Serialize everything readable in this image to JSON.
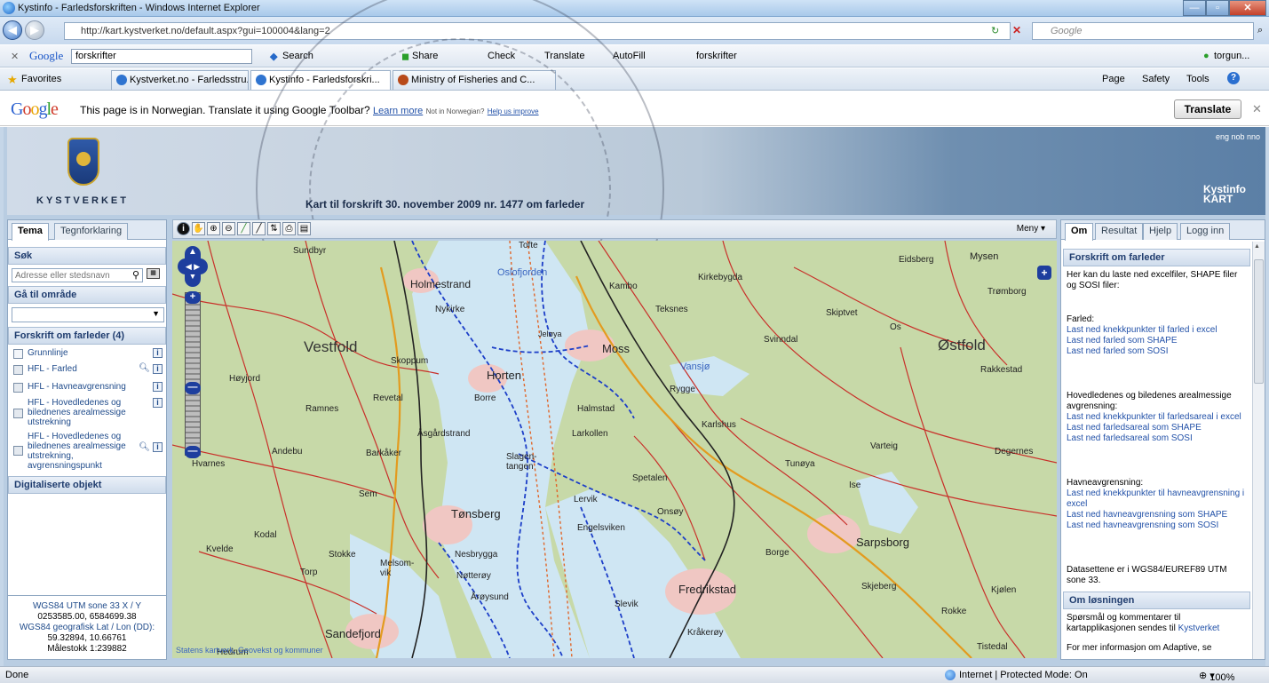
{
  "window": {
    "title": "Kystinfo - Farledsforskriften - Windows Internet Explorer"
  },
  "address": {
    "url": "http://kart.kystverket.no/default.aspx?gui=100004&lang=2",
    "search_placeholder": "Google"
  },
  "google_toolbar": {
    "query": "forskrifter",
    "search": "Search",
    "share": "Share",
    "check": "Check",
    "translate": "Translate",
    "autofill": "AutoFill",
    "highlight_term": "forskrifter",
    "user": "torgun..."
  },
  "favorites": {
    "label": "Favorites",
    "tabs": [
      "Kystverket.no - Farledsstru...",
      "Kystinfo - Farledsforskri...",
      "Ministry of Fisheries and C..."
    ],
    "commands": {
      "page": "Page",
      "safety": "Safety",
      "tools": "Tools"
    }
  },
  "translate_bar": {
    "message": "This page is in Norwegian.  Translate it using Google Toolbar?",
    "learn_more": "Learn more",
    "not_norwegian": "Not in Norwegian?",
    "help": "Help us improve",
    "button": "Translate"
  },
  "banner": {
    "brand": "KYSTVERKET",
    "subtitle": "Kart til forskrift 30. november 2009 nr. 1477 om farleder",
    "languages": "eng nob nno",
    "product_line1": "Kystinfo",
    "product_line2": "KART"
  },
  "left_panel": {
    "tabs": [
      "Tema",
      "Tegnforklaring"
    ],
    "search_title": "Søk",
    "search_placeholder": "Adresse eller stedsnavn",
    "goto_title": "Gå til område",
    "layers_title": "Forskrift om farleder (4)",
    "layers": [
      {
        "label": "Grunnlinje"
      },
      {
        "label": "HFL - Farled"
      },
      {
        "label": "HFL - Havneavgrensning"
      },
      {
        "label": "HFL - Hovedledenes og bilednenes arealmessige utstrekning"
      },
      {
        "label": "HFL - Hovedledenes og bilednenes arealmessige utstrekning, avgrensningspunkt"
      }
    ],
    "digital_title": "Digitaliserte objekt",
    "coords": {
      "utm_label": "WGS84 UTM sone 33 X / Y",
      "utm_value": "0253585.00, 6584699.38",
      "geo_label": "WGS84 geografisk Lat / Lon (DD):",
      "geo_value": "59.32894, 10.66761",
      "scale": "Målestokk 1:239882"
    }
  },
  "map": {
    "menu": "Meny",
    "copyright": "Statens kartverk, Geovekst og kommuner",
    "labels": {
      "vestfold": "Vestfold",
      "ostfold": "Østfold",
      "holmestrand": "Holmestrand",
      "oslofjorden": "Oslofjorden",
      "moss": "Moss",
      "horten": "Horten",
      "tonsberg": "Tønsberg",
      "sarpsborg": "Sarpsborg",
      "fredrikstad": "Fredrikstad",
      "sandefjord": "Sandefjord",
      "kambo": "Kambo",
      "kirkebygda": "Kirkebygda",
      "teksnes": "Teksnes",
      "rygge": "Rygge",
      "halmstad": "Halmstad",
      "larkollen": "Larkollen",
      "borre": "Borre",
      "revetal": "Revetal",
      "ramnes": "Ramnes",
      "andebu": "Andebu",
      "kodal": "Kodal",
      "stokke": "Stokke",
      "notteroy": "Nøtterøy",
      "nesbyggda": "Nesbrygga",
      "slagentangen": "Slagen-tangen",
      "spetalen": "Spetalen",
      "onsoy": "Onsøy",
      "engelsviken": "Engelsviken",
      "rakkestad": "Rakkestad",
      "degernes": "Degernes",
      "tunoya": "Tunøya",
      "eidsberg": "Eidsberg",
      "mysen": "Mysen",
      "tromborg": "Trømborg",
      "skiptvet": "Skiptvet",
      "svinndal": "Svinndal",
      "vansjo": "Vansjø",
      "jeloya": "Jeløya",
      "nykirke": "Nykirke",
      "skoppum": "Skoppum",
      "asgardstrand": "Åsgårdstrand",
      "barkaker": "Barkåker",
      "hvarnes": "Hvarnes",
      "kvelde": "Kvelde",
      "sem": "Sem",
      "torp": "Torp",
      "melsomvik": "Melsom-vik",
      "arøysund": "Årøysund",
      "slevik": "Slevik",
      "krakeroy": "Kråkerøy",
      "skjeberg": "Skjeberg",
      "kjolen": "Kjølen",
      "rokke": "Rokke",
      "tistedal": "Tistedal",
      "karlshus": "Karlshus",
      "varteig": "Varteig",
      "ise": "Ise",
      "borge": "Borge",
      "levik": "Lervik",
      "hoyjord": "Høyjord",
      "hedrum": "Hedrum",
      "os": "Os",
      "tofte": "Tofte",
      "sundbyr": "Sundbyr"
    }
  },
  "right_panel": {
    "tabs": [
      "Om",
      "Resultat",
      "Hjelp",
      "Logg inn"
    ],
    "section1_title": "Forskrift om farleder",
    "intro": "Her kan du laste ned excelfiler, SHAPE filer og SOSI filer:",
    "farled_heading": "Farled:",
    "farled_links": [
      "Last ned knekkpunkter til farled i excel",
      "Last ned farled som SHAPE",
      "Last ned farled som SOSI"
    ],
    "hoved_heading": "Hovedledenes og biledenes arealmessige avgrensning:",
    "hoved_links": [
      "Last ned knekkpunkter til farledsareal i excel",
      "Last ned farledsareal som SHAPE",
      "Last ned farledsareal som SOSI"
    ],
    "havne_heading": "Havneavgrensning:",
    "havne_links": [
      "Last ned knekkpunkter til havneavgrensning i excel",
      "Last ned havneavgrensning som SHAPE",
      "Last ned havneavgrensning som SOSI"
    ],
    "datasett": "Datasettene er i WGS84/EUREF89 UTM sone 33.",
    "section2_title": "Om løsningen",
    "sporsmal": "Spørsmål og kommentarer til kartapplikasjonen sendes til",
    "kystverket_link": "Kystverket",
    "mer_info": "For mer informasjon om Adaptive, se"
  },
  "status": {
    "left": "Done",
    "zone": "Internet | Protected Mode: On",
    "zoom": "100%"
  }
}
